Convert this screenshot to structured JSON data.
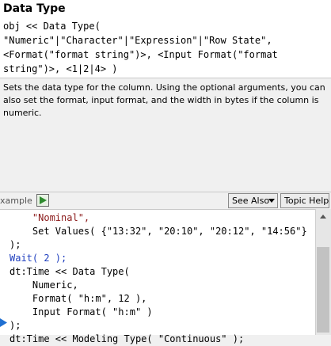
{
  "header": {
    "title": "Data Type",
    "syntax_lines": [
      "obj << Data Type(",
      "\"Numeric\"|\"Character\"|\"Expression\"|\"Row State\",",
      "<Format(\"format string\")>, <Input Format(\"format",
      "string\")>, <1|2|4> )"
    ]
  },
  "description": "Sets the data type for the column. Using the optional arguments, you can also set the format, input format, and the width in bytes if the column is numeric.",
  "toolbar": {
    "example_label": "xample",
    "see_also_label": "See Also",
    "topic_help_label": "Topic Help"
  },
  "code": {
    "lines": [
      "    \"Nominal\",",
      "    Set Values( {\"13:32\", \"20:10\", \"20:12\", \"14:56\"}",
      ");",
      "Wait( 2 );",
      "dt:Time << Data Type(",
      "    Numeric,",
      "    Format( \"h:m\", 12 ),",
      "    Input Format( \"h:m\" )",
      ");",
      "dt:Time << Modeling Type( \"Continuous\" );"
    ]
  },
  "colors": {
    "string": "#8b1a1a",
    "keyword": "#1f3fbf",
    "run_icon": "#2e8b2e",
    "breakpoint_marker": "#1f6fd1"
  },
  "icons": {
    "run": "run-script-icon",
    "dropdown": "chevron-down-icon",
    "marker": "current-line-arrow-icon"
  }
}
